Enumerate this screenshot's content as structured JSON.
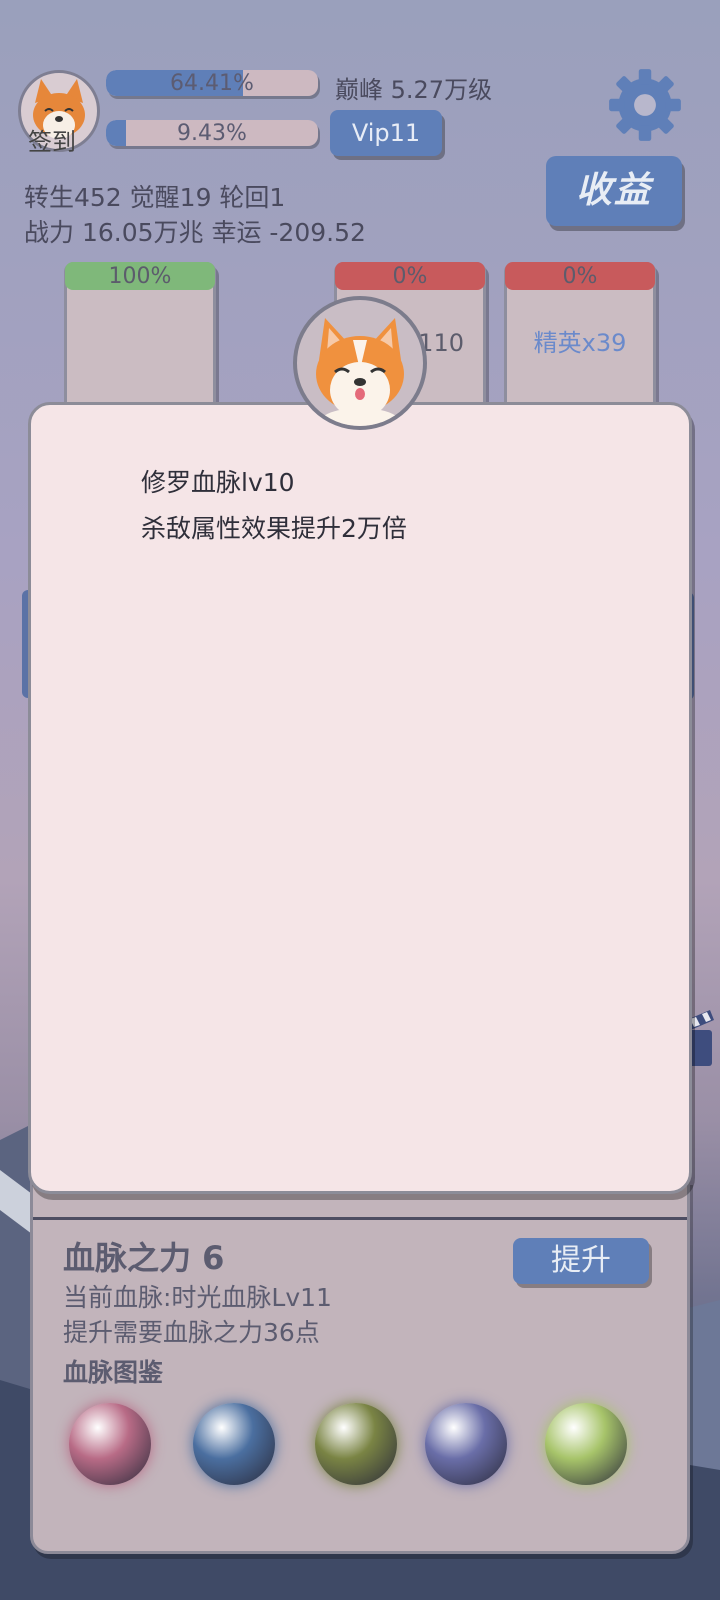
{
  "hud": {
    "signin_label": "签到",
    "progress_bar_1": {
      "value_pct": 64.41,
      "label": "64.41%"
    },
    "progress_bar_2": {
      "value_pct": 9.43,
      "label": "9.43%"
    },
    "peak_level": "巅峰 5.27万级",
    "vip_label": "Vip11",
    "stats_line1": "转生452 觉醒19 轮回1",
    "stats_line2": "战力 16.05万兆  幸运 -209.52",
    "income_label": "收益",
    "icons": {
      "settings": "gear-icon",
      "avatar": "corgi-avatar-icon"
    }
  },
  "cards": [
    {
      "percent": "100%",
      "label": "",
      "head_color": "#7fb87a",
      "label_color": "#5c5c6c"
    },
    {
      "percent": "0%",
      "label": "小怪x110",
      "head_color": "#c85a5c",
      "label_color": "#5c5c6c"
    },
    {
      "percent": "0%",
      "label": "精英x39",
      "head_color": "#c85a5c",
      "label_color": "#6b8acb"
    }
  ],
  "dialog": {
    "line1": "修罗血脉lv10",
    "line2": "杀敌属性效果提升2万倍",
    "icon": "corgi-icon"
  },
  "bloodline": {
    "title": "血脉之力 6",
    "current": "当前血脉:时光血脉Lv11",
    "requirement": "提升需要血脉之力36点",
    "gallery_label": "血脉图鉴",
    "upgrade_label": "提升",
    "orbs": [
      {
        "name": "fire-dragon-orb-icon",
        "color": "#b86b86"
      },
      {
        "name": "water-spirit-orb-icon",
        "color": "#4b6fa0"
      },
      {
        "name": "earth-spirit-orb-icon",
        "color": "#7a8444"
      },
      {
        "name": "shadow-beast-orb-icon",
        "color": "#6a6ea8"
      },
      {
        "name": "nature-flame-orb-icon",
        "color": "#a7c46a"
      }
    ]
  },
  "colors": {
    "accent": "#5f7fb8",
    "dialog_bg": "#f5e5e7",
    "panel_bg": "#c2b4bb"
  }
}
